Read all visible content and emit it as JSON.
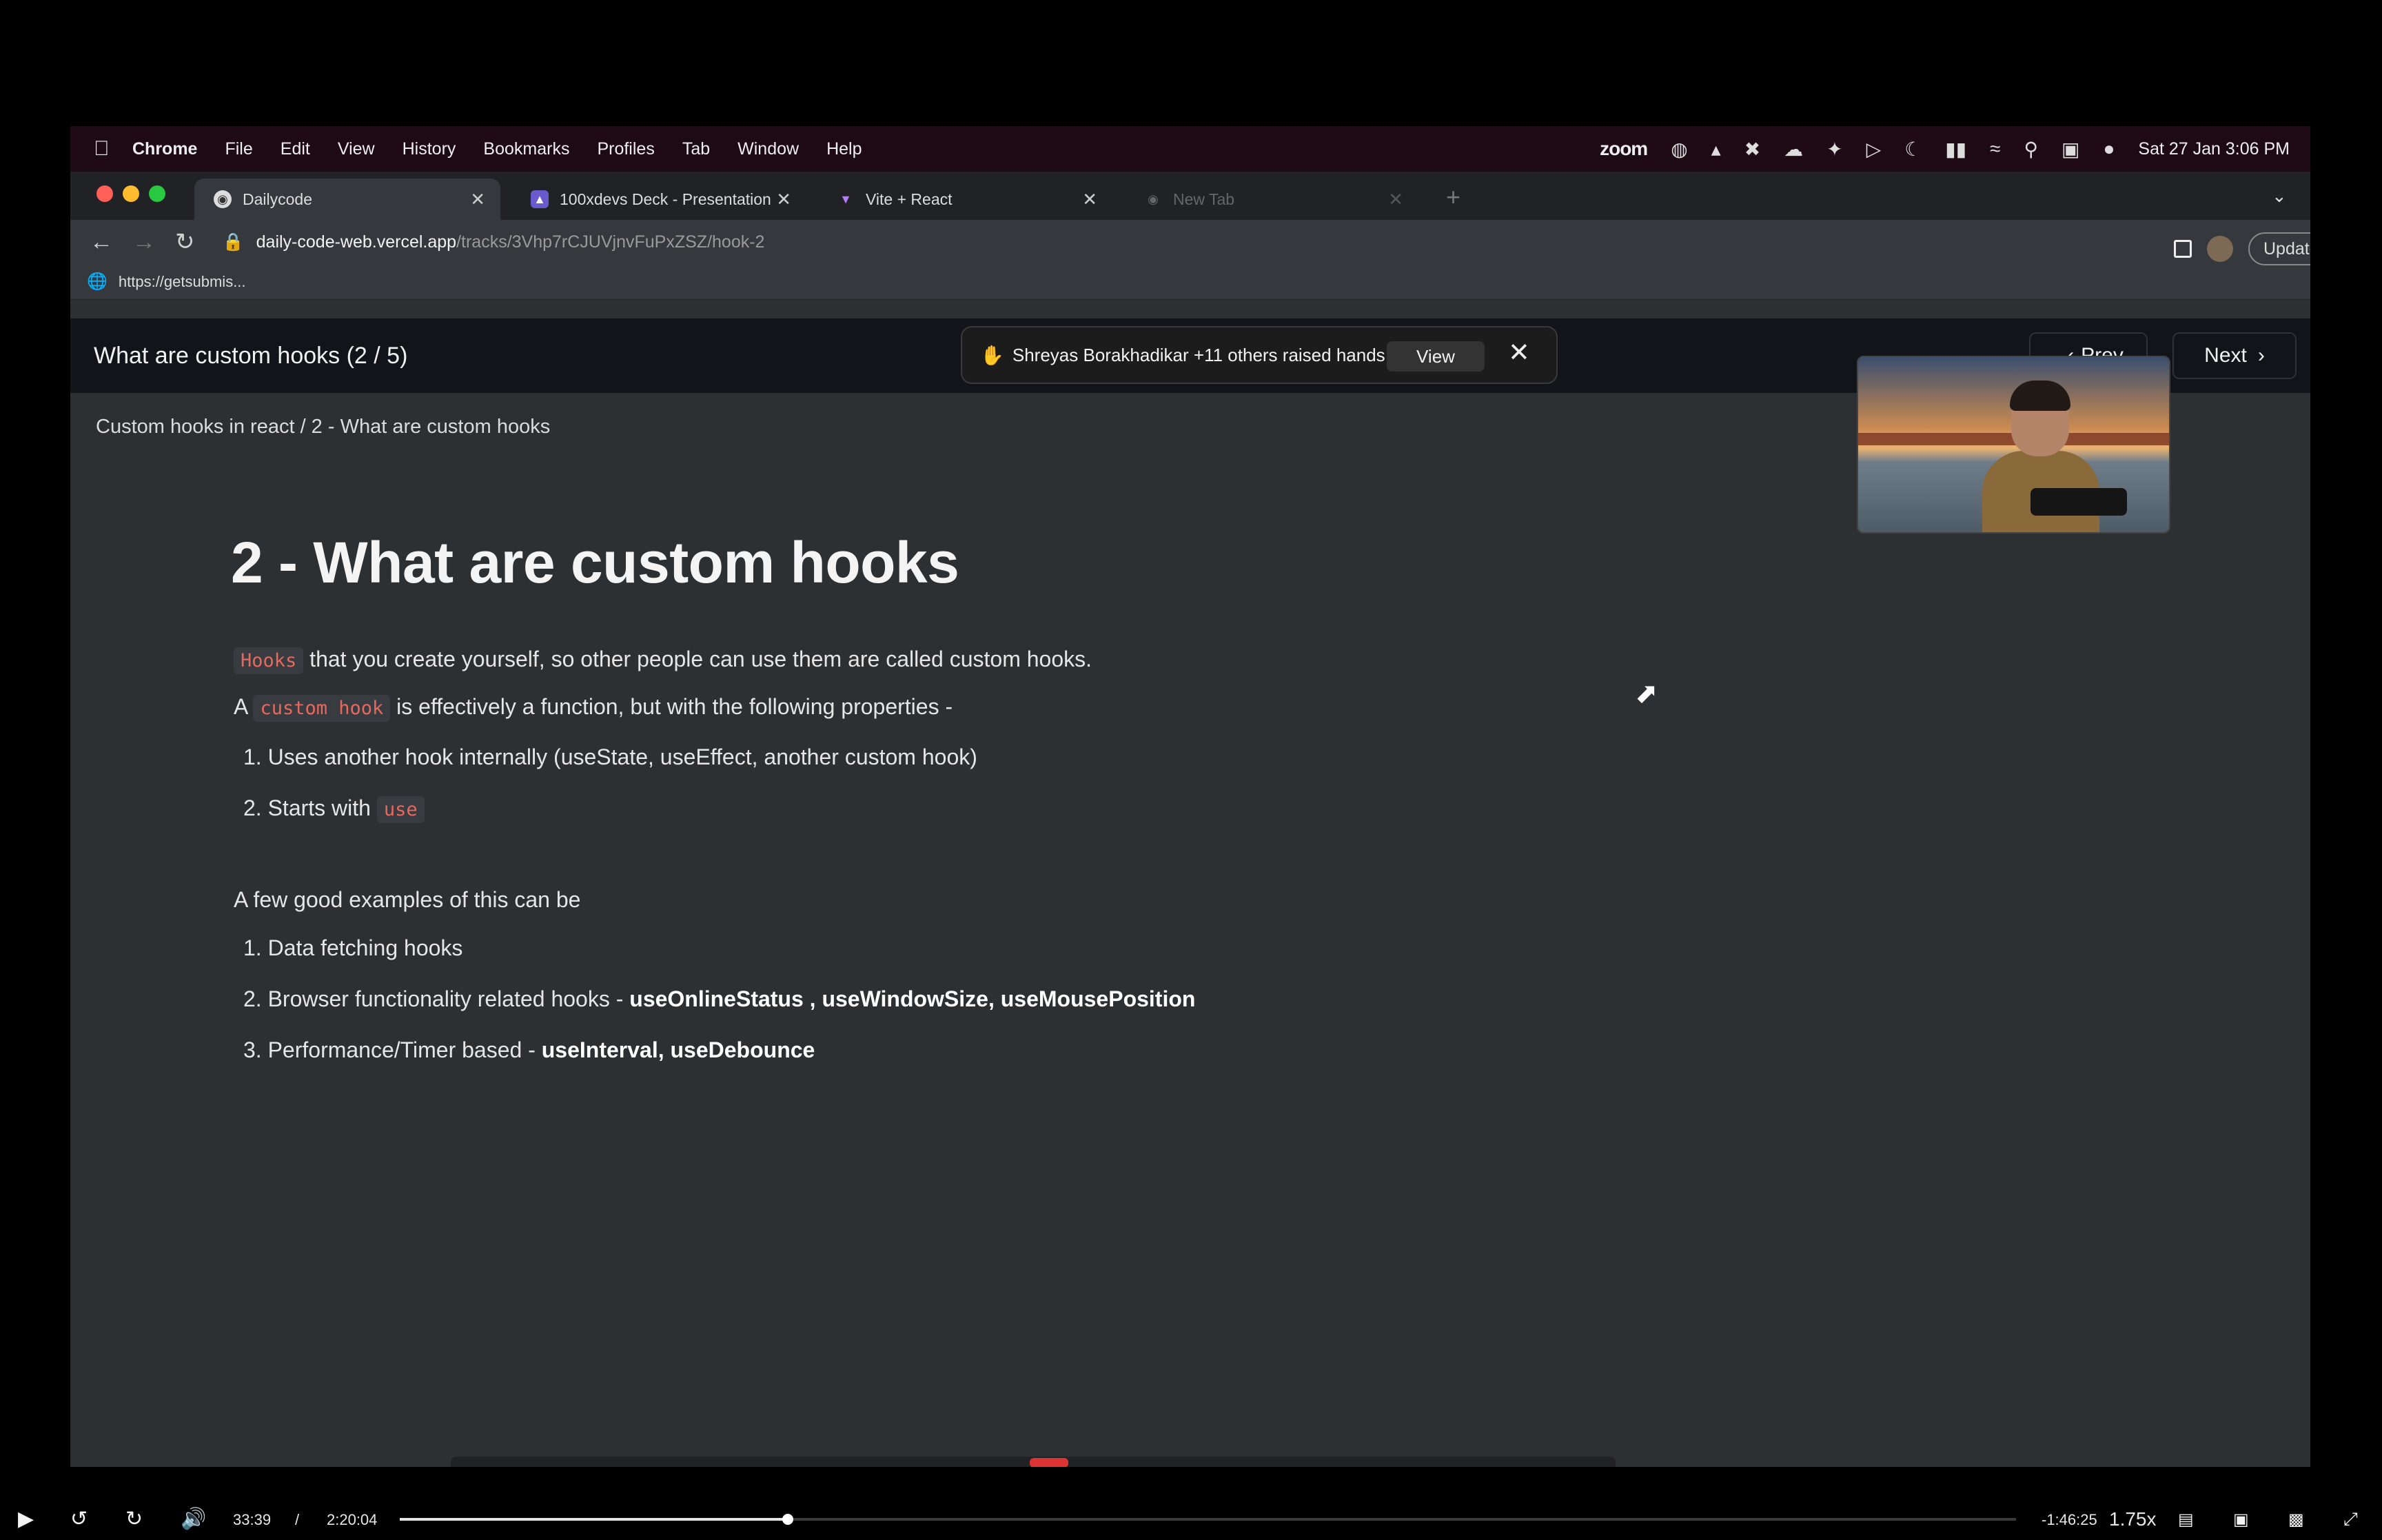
{
  "menubar": {
    "apple_icon": "apple-icon",
    "app_name": "Chrome",
    "items": [
      "File",
      "Edit",
      "View",
      "History",
      "Bookmarks",
      "Profiles",
      "Tab",
      "Window",
      "Help"
    ],
    "zoom_label": "zoom",
    "datetime": "Sat 27 Jan  3:06 PM"
  },
  "browser": {
    "tabs": [
      {
        "label": "Dailycode"
      },
      {
        "label": "100xdevs Deck - Presentation"
      },
      {
        "label": "Vite + React"
      },
      {
        "label": "New Tab"
      }
    ],
    "url_host": "daily-code-web.vercel.app",
    "url_path": "/tracks/3Vhp7rCJUVjnvFuPxZSZ/hook-2",
    "bookmark": "https://getsubmis...",
    "update_label": "Update"
  },
  "zoom_overlay": {
    "raised_hands_text": "Shreyas Borakhadikar +11 others raised hands",
    "view_label": "View"
  },
  "page": {
    "header_title": "What are custom hooks (2 / 5)",
    "prev_label": "Prev",
    "next_label": "Next",
    "breadcrumb": "Custom hooks in react  /  2 - What are custom hooks",
    "heading": "2 - What are custom hooks",
    "para1_code": "Hooks",
    "para1_text": " that you create yourself, so other people can use them are called custom hooks.",
    "para2_prefix": "A ",
    "para2_code": "custom hook",
    "para2_text": " is effectively a function, but with the following properties -",
    "props": {
      "item1": "1. Uses another hook internally (useState, useEffect, another custom hook)",
      "item2_prefix": "2. Starts with ",
      "item2_code": "use"
    },
    "examples_intro": "A few good examples of this can be",
    "examples": {
      "item1": "1. Data fetching hooks",
      "item2_prefix": "2. Browser functionality related hooks - ",
      "item2_bold": "useOnlineStatus , useWindowSize, useMousePosition",
      "item3_prefix": "3. Performance/Timer based - ",
      "item3_bold": "useInterval, useDebounce"
    }
  },
  "player": {
    "current_time": "33:39",
    "separator": "/",
    "duration": "2:20:04",
    "remaining": "-1:46:25",
    "speed": "1.75x",
    "progress_fraction": 0.24
  }
}
